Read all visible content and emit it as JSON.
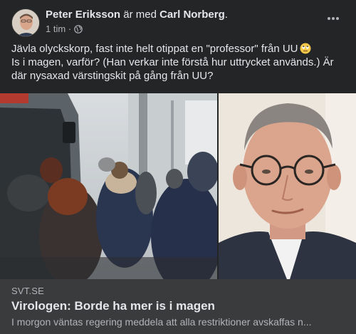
{
  "post": {
    "author": "Peter Eriksson",
    "with_text": "är med",
    "tagged": "Carl Norberg",
    "tagged_suffix": ".",
    "time": "1 tim",
    "separator": "·",
    "privacy_icon": "globe-icon",
    "menu_icon": "more-options-icon",
    "text_lines": [
      "Jävla olyckskorp, fast inte helt otippat en \"professor\" från UU",
      "Is i magen, varför? (Han verkar inte förstå hur uttrycket används.) Är",
      "där nysaxad värstingskit på gång från UU?"
    ],
    "emoji": "face-with-rolling-eyes-icon"
  },
  "link_preview": {
    "source": "SVT.SE",
    "headline": "Virologen: Borde ha mer is i magen",
    "description": "I morgon väntas regering meddela att alla restriktioner avskaffas n..."
  },
  "colors": {
    "post_background": "#242526",
    "link_background": "#3a3b3c",
    "primary_text": "#e4e6eb",
    "secondary_text": "#b0b3b8"
  }
}
